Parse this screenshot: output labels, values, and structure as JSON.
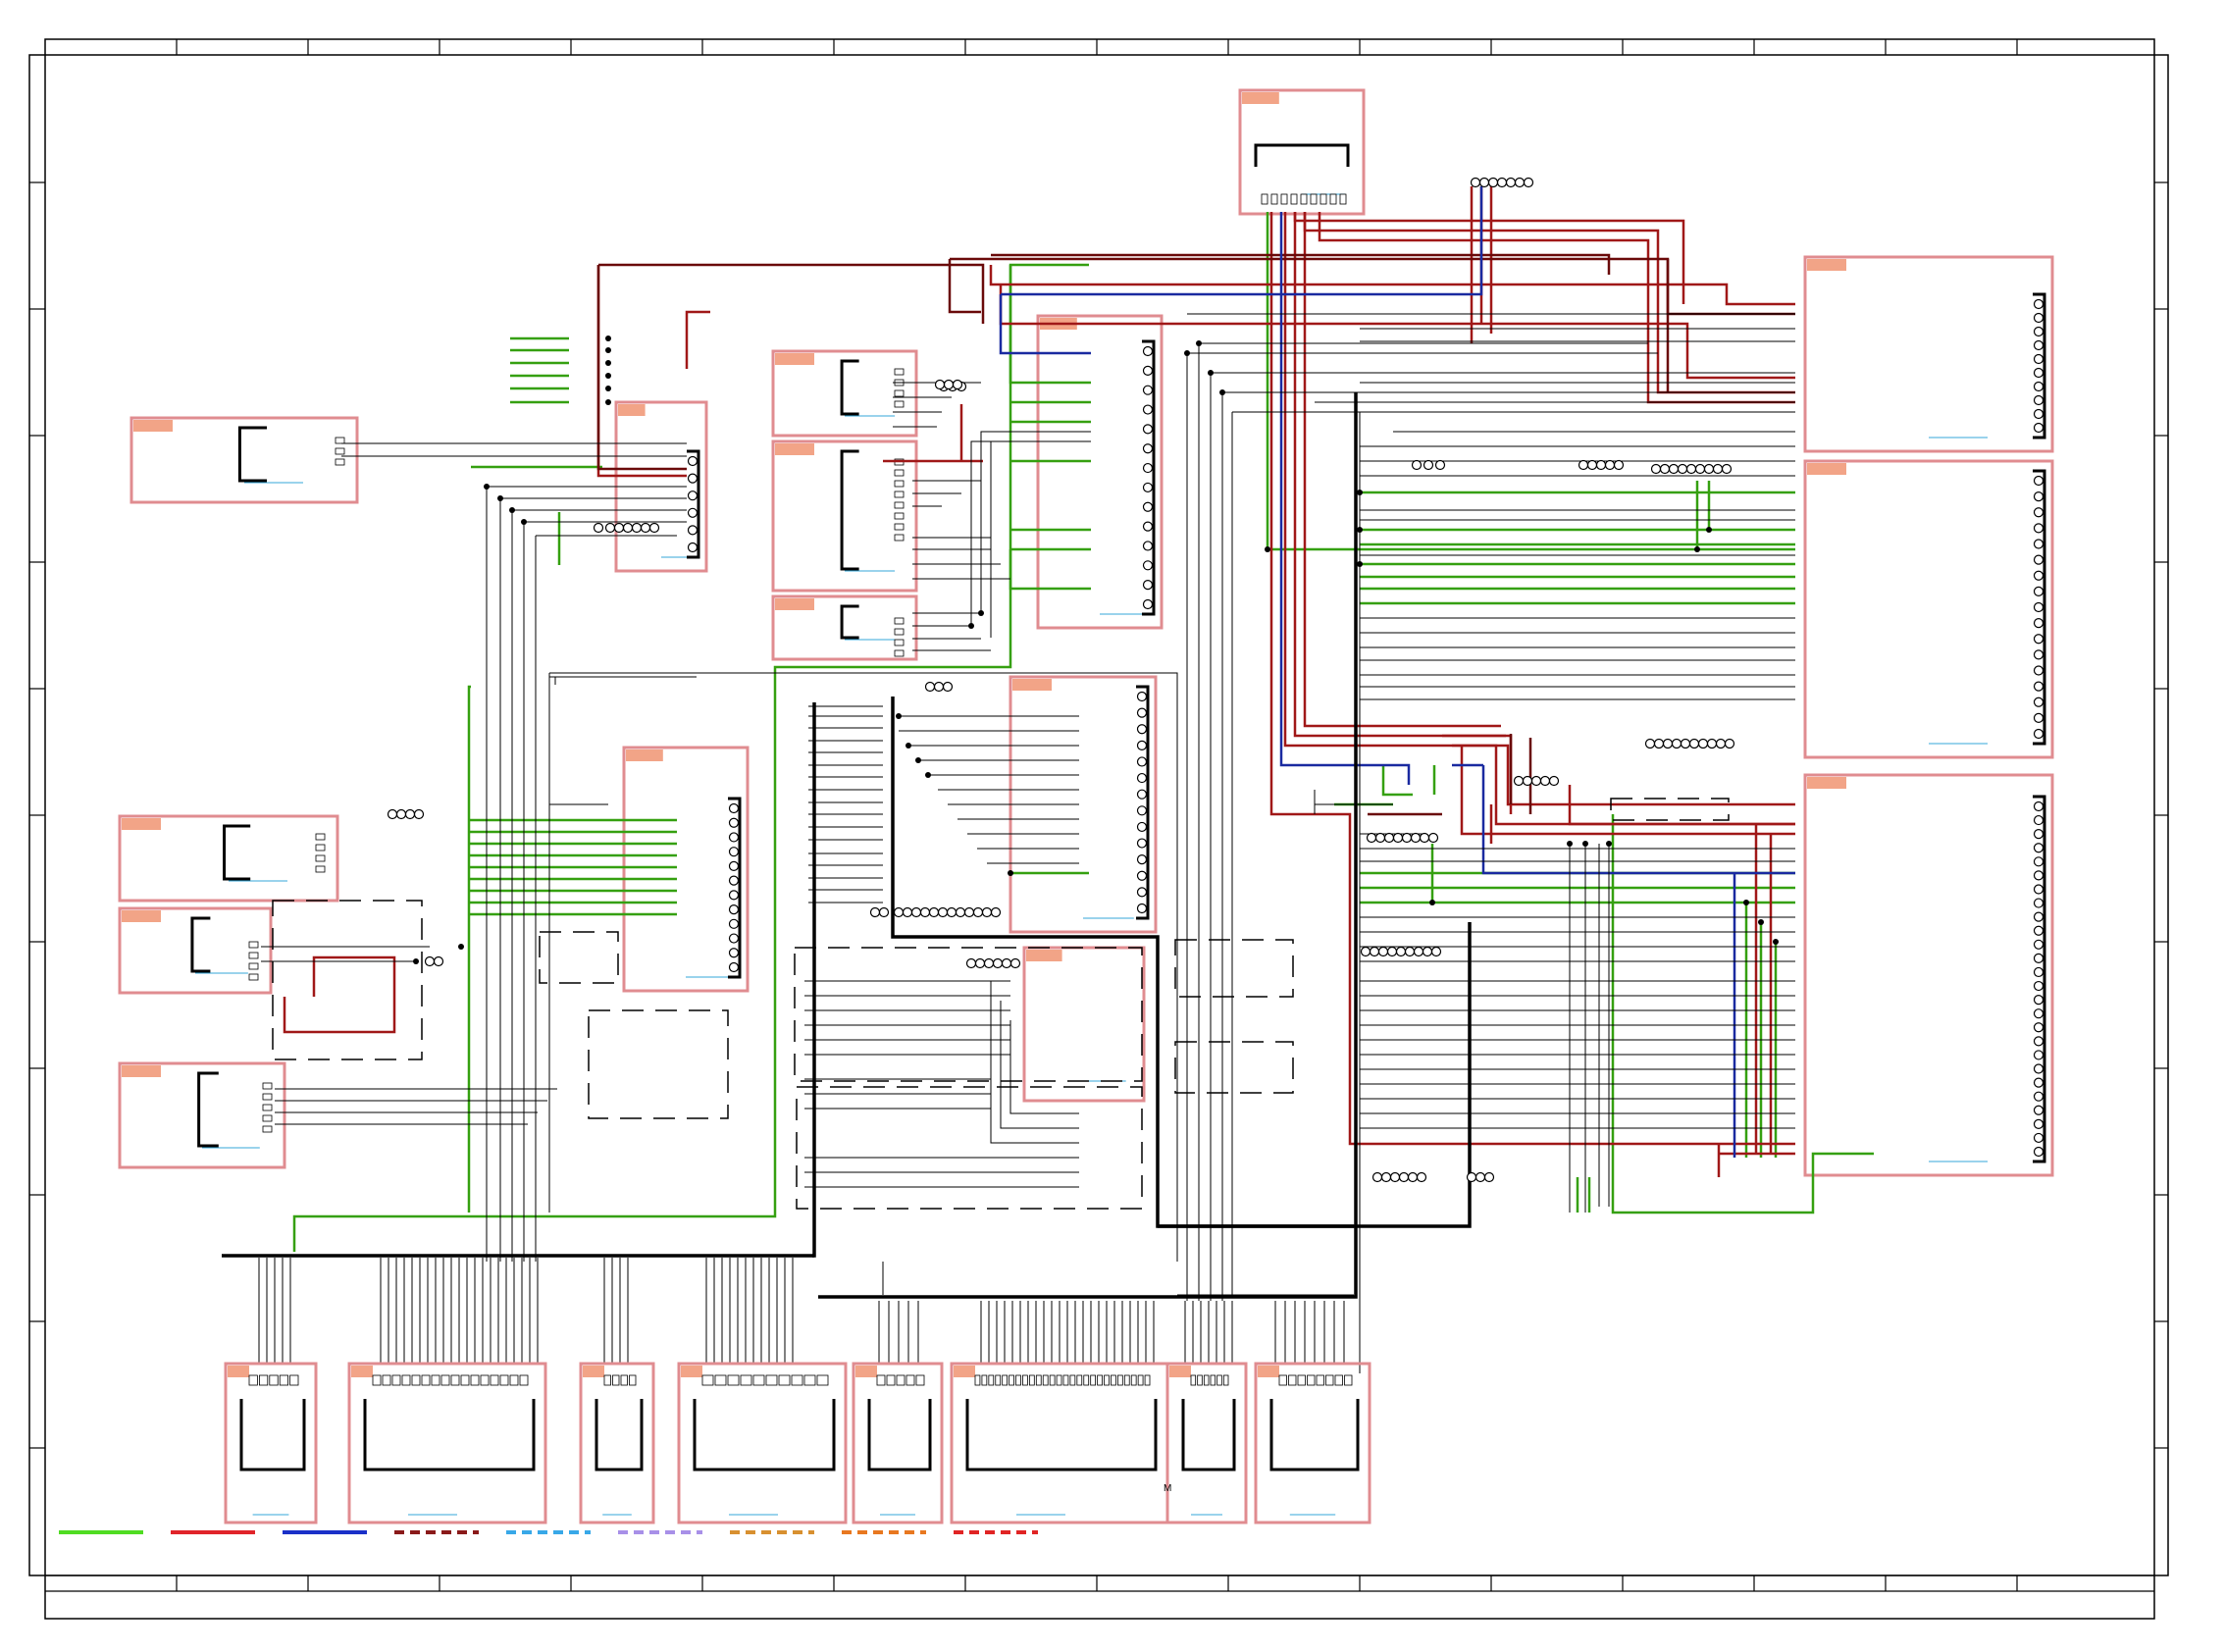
{
  "sheet": {
    "type": "wiring-diagram",
    "border_color": "#000000",
    "component_box_color": "#e08c90",
    "component_tag_color": "#f2a487",
    "label_underline_color": "#35a7d9"
  },
  "wire_colors": {
    "green": "#35a010",
    "dark_red": "#a01818",
    "dark_maroon": "#6a0a0a",
    "blue": "#1a2aa0",
    "black": "#000000",
    "gray": "#666666"
  },
  "legend": {
    "visible_labels": [],
    "samples": [
      {
        "color": "#4fdc22",
        "style": "solid"
      },
      {
        "color": "#e0242a",
        "style": "solid"
      },
      {
        "color": "#1a30c8",
        "style": "solid"
      },
      {
        "color": "#8a1a1a",
        "style": "dashed"
      },
      {
        "color": "#38a8e8",
        "style": "dashed"
      },
      {
        "color": "#a890e8",
        "style": "dashed"
      },
      {
        "color": "#d89030",
        "style": "dashed"
      },
      {
        "color": "#e87820",
        "style": "dashed"
      },
      {
        "color": "#e02424",
        "style": "dashed"
      }
    ]
  },
  "components_count": 26,
  "marker_text": "M"
}
